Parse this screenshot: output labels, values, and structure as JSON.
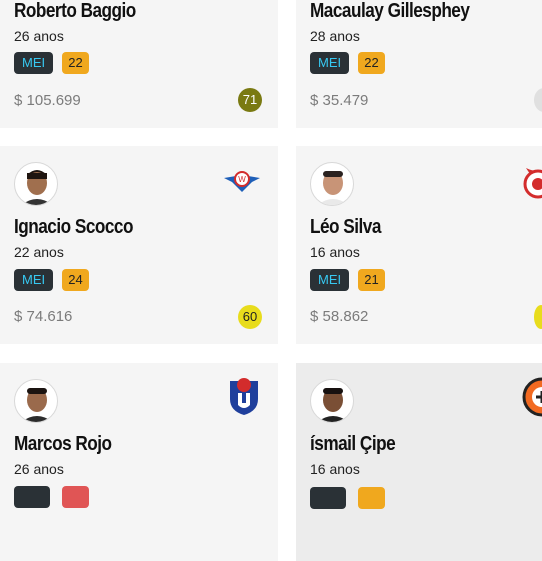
{
  "cards": [
    {
      "name": "Roberto Baggio",
      "age": "26 anos",
      "position": "MEI",
      "number": "22",
      "price": "$ 105.699",
      "score": "71",
      "score_color": "#7a7a12"
    },
    {
      "name": "Macaulay Gillesphey",
      "age": "28 anos",
      "position": "MEI",
      "number": "22",
      "price": "$ 35.479"
    },
    {
      "name": "Ignacio Scocco",
      "age": "22 anos",
      "position": "MEI",
      "number": "24",
      "price": "$ 74.616",
      "score": "60",
      "score_color": "#e8dc1c",
      "crest": "jorge-wilstermann-crest-icon"
    },
    {
      "name": "Léo Silva",
      "age": "16 anos",
      "position": "MEI",
      "number": "21",
      "price": "$ 58.862",
      "crest": "benfica-crest-icon"
    },
    {
      "name": "Marcos Rojo",
      "age": "26 anos",
      "crest": "universidad-de-chile-crest-icon"
    },
    {
      "name": "ísmail Çipe",
      "age": "16 anos",
      "crest": "shakhtar-crest-icon"
    }
  ],
  "colors": {
    "position_bg": "#2a3136",
    "position_text": "#37c9f2",
    "number_bg": "#f0a81e",
    "number_red": "#e05555"
  }
}
